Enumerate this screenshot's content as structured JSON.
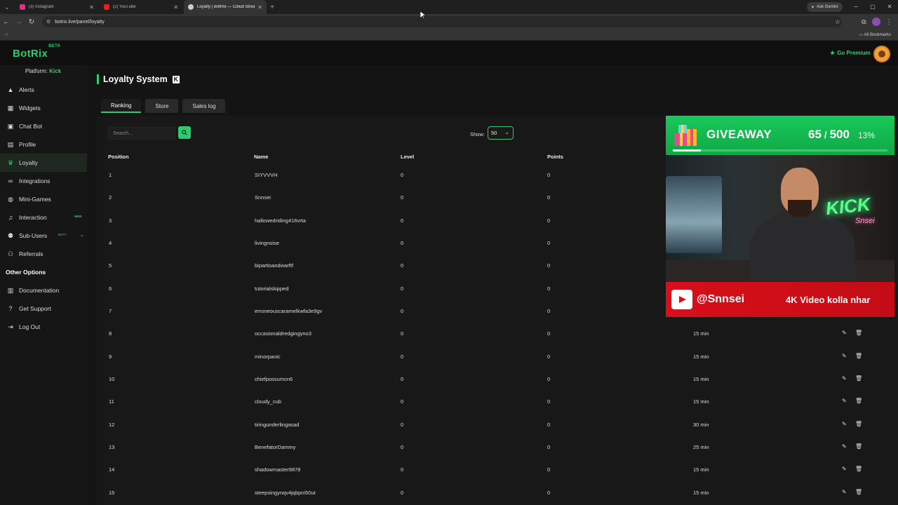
{
  "browser": {
    "tabs": [
      {
        "title": "(3) Instagram",
        "color": "#d6338a"
      },
      {
        "title": "(2) YouTube",
        "color": "#e62117"
      },
      {
        "title": "Loyalty | BotRix — Cloud Stream",
        "color": "#cccccc"
      }
    ],
    "ask_gemini": "Ask Gemini",
    "url": "botrix.live/panel/loyalty",
    "all_bookmarks": "All Bookmarks"
  },
  "app": {
    "logo": "BotRix",
    "logo_badge": "BETA",
    "go_premium": "Go Premium",
    "accent": "#2ecc71"
  },
  "sidebar": {
    "platform_label": "Platform:",
    "platform_value": "Kick",
    "items": [
      {
        "label": "Alerts",
        "icon": "warning-icon"
      },
      {
        "label": "Widgets",
        "icon": "grid-icon"
      },
      {
        "label": "Chat Bot",
        "icon": "chat-icon"
      },
      {
        "label": "Profile",
        "icon": "id-card-icon"
      },
      {
        "label": "Loyalty",
        "icon": "trophy-icon",
        "active": true
      },
      {
        "label": "Integrations",
        "icon": "link-icon"
      },
      {
        "label": "Mini-Games",
        "icon": "gamepad-icon"
      },
      {
        "label": "Interaction",
        "icon": "music-icon",
        "badge": "NEW"
      },
      {
        "label": "Sub-Users",
        "icon": "users-icon",
        "badge": "BETA"
      },
      {
        "label": "Referrals",
        "icon": "people-icon"
      }
    ],
    "other_title": "Other Options",
    "other_items": [
      {
        "label": "Documentation",
        "icon": "book-icon"
      },
      {
        "label": "Get Support",
        "icon": "question-icon"
      },
      {
        "label": "Log Out",
        "icon": "logout-icon"
      }
    ]
  },
  "main": {
    "title": "Loyalty System",
    "tabs": [
      "Ranking",
      "Store",
      "Sales log"
    ],
    "search_placeholder": "Search...",
    "show_label": "Show:",
    "show_value": "50",
    "columns": [
      "Position",
      "Name",
      "Level",
      "Points"
    ],
    "rows": [
      {
        "pos": "1",
        "name": "SIYVVVH",
        "level": "0",
        "points": "0",
        "time": ""
      },
      {
        "pos": "2",
        "name": "Snnsei",
        "level": "0",
        "points": "0",
        "time": ""
      },
      {
        "pos": "3",
        "name": "hallowedriding416vrta",
        "level": "0",
        "points": "0",
        "time": ""
      },
      {
        "pos": "4",
        "name": "livingnoise",
        "level": "0",
        "points": "0",
        "time": ""
      },
      {
        "pos": "5",
        "name": "bipartisandwarftf",
        "level": "0",
        "points": "0",
        "time": ""
      },
      {
        "pos": "6",
        "name": "tutorialskipped",
        "level": "0",
        "points": "0",
        "time": ""
      },
      {
        "pos": "7",
        "name": "erroneouscaramelkwfa3e9gv",
        "level": "0",
        "points": "0",
        "time": ""
      },
      {
        "pos": "8",
        "name": "occasionaldredgingyno3",
        "level": "0",
        "points": "0",
        "time": "15 min"
      },
      {
        "pos": "9",
        "name": "minorpanic",
        "level": "0",
        "points": "0",
        "time": "15 min"
      },
      {
        "pos": "10",
        "name": "chiefpossumcn6",
        "level": "0",
        "points": "0",
        "time": "15 min"
      },
      {
        "pos": "11",
        "name": "cloudy_cub",
        "level": "0",
        "points": "0",
        "time": "15 min"
      },
      {
        "pos": "12",
        "name": "tiringunderlingasad",
        "level": "0",
        "points": "0",
        "time": "30 min"
      },
      {
        "pos": "13",
        "name": "BenefatorDammy",
        "level": "0",
        "points": "0",
        "time": "25 min"
      },
      {
        "pos": "14",
        "name": "shadowmaster9878",
        "level": "0",
        "points": "0",
        "time": "15 min"
      },
      {
        "pos": "15",
        "name": "steepsingynqv4jqbpni50ut",
        "level": "0",
        "points": "0",
        "time": "15 min"
      }
    ]
  },
  "overlay": {
    "giveaway_label": "GIVEAWAY",
    "count": "65",
    "total": "500",
    "percent": "13%",
    "progress": 0.13,
    "neon_text": "KICK",
    "neon_sub": "Snsei",
    "youtube_handle": "@Snnsei",
    "video_text": "4K Video kolla nhar"
  }
}
